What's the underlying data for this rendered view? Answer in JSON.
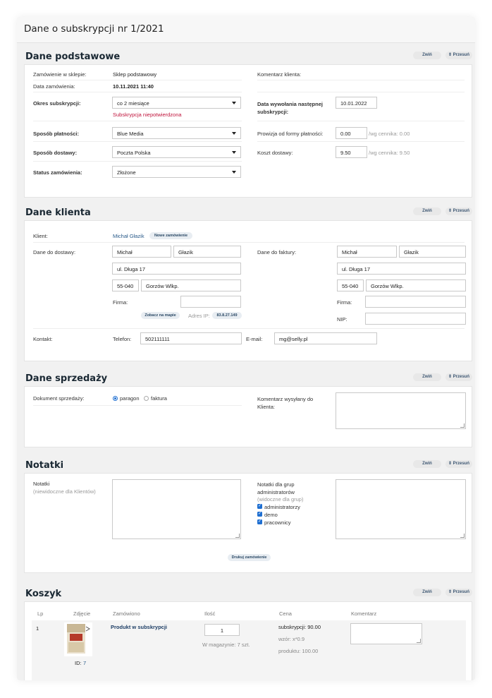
{
  "page": {
    "title": "Dane o subskrypcji nr 1/2021"
  },
  "header_buttons": {
    "collapse": "Zwiń",
    "move": "⇕ Przesuń"
  },
  "basic": {
    "title": "Dane podstawowe",
    "shop_label": "Zamówienie w sklepie:",
    "shop_value": "Sklep podstawowy",
    "date_label": "Data zamówienia:",
    "date_value": "10.11.2021 11:40",
    "period_label": "Okres subskrypcji:",
    "period_value": "co 2 miesiące",
    "unconfirmed": "Subskrypcja niepotwierdzona",
    "payment_label": "Sposób płatności:",
    "payment_value": "Blue Media",
    "delivery_label": "Sposób dostawy:",
    "delivery_value": "Poczta Polska",
    "status_label": "Status zamówienia:",
    "status_value": "Złożone",
    "comment_label": "Komentarz klienta:",
    "next_call_label": "Data wywołania następnej subskrypcji:",
    "next_call_value": "10.01.2022",
    "commission_label": "Prowizja od formy płatności:",
    "commission_value": "0.00",
    "commission_hint": "/wg cennika: 0.00",
    "shipping_cost_label": "Koszt dostawy:",
    "shipping_cost_value": "9.50",
    "shipping_cost_hint": "/wg cennika: 9.50"
  },
  "client": {
    "title": "Dane klienta",
    "client_label": "Klient:",
    "client_name": "Michał Głazik",
    "new_order": "Nowe zamówienie",
    "delivery_label": "Dane do dostawy:",
    "invoice_label": "Dane do faktury:",
    "first_name": "Michał",
    "last_name": "Głazik",
    "street": "ul. Długa 17",
    "zip": "55-040",
    "city": "Gorzów Wlkp.",
    "company_label": "Firma:",
    "nip_label": "NIP:",
    "map_button": "Zobacz na mapie",
    "ip_label": "Adres IP:",
    "ip_value": "83.8.27.149",
    "contact_label": "Kontakt:",
    "phone_label": "Telefon:",
    "phone_value": "502111111",
    "email_label": "E-mail:",
    "email_value": "mg@selly.pl"
  },
  "sales": {
    "title": "Dane sprzedaży",
    "doc_label": "Dokument sprzedaży:",
    "receipt": "paragon",
    "invoice": "faktura",
    "comment_label": "Komentarz wysyłany do Klienta:"
  },
  "notes": {
    "title": "Notatki",
    "notes_label": "Notatki",
    "notes_sub": "(niewidoczne dla Klientów)",
    "group_label": "Notatki dla grup administratorów",
    "group_sub": "(widoczne dla grup)",
    "groups": [
      "administratorzy",
      "demo",
      "pracownicy"
    ],
    "print_button": "Drukuj zamówienie"
  },
  "cart": {
    "title": "Koszyk",
    "headers": {
      "lp": "Lp",
      "photo": "Zdjęcie",
      "ordered": "Zamówiono",
      "qty": "Ilość",
      "price": "Cena",
      "comment": "Komentarz"
    },
    "row": {
      "lp": "1",
      "id_label": "ID:",
      "id_value": "7",
      "product": "Produkt w subskrypcji",
      "qty": "1",
      "stock": "W magazynie: 7 szt.",
      "price_sub": "subskrypcji: 90.00",
      "price_formula": "wzór: x*0.9",
      "price_product": "produktu: 100.00"
    }
  }
}
